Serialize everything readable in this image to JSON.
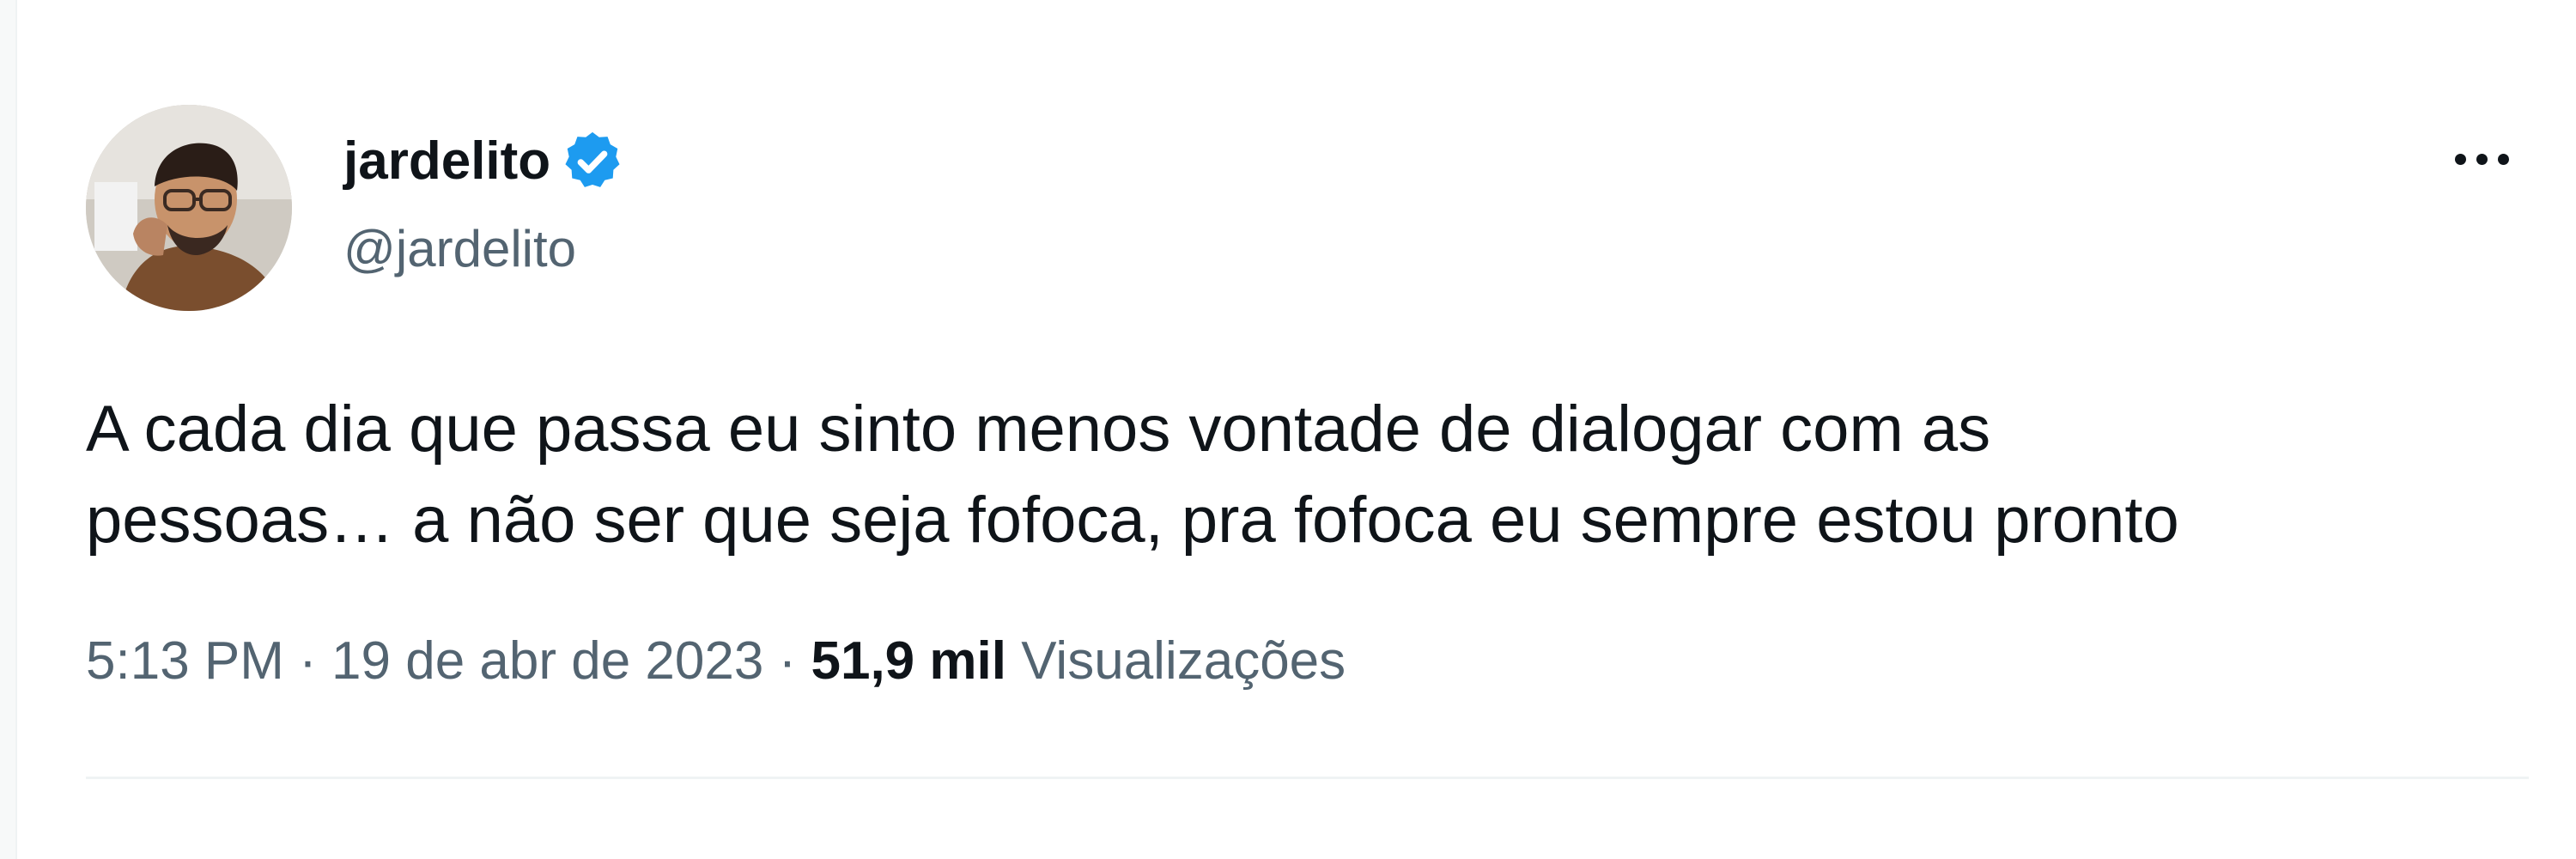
{
  "tweet": {
    "display_name": "jardelito",
    "handle": "@jardelito",
    "verified": true,
    "text": "A cada dia que passa eu sinto menos vontade de dialogar com as\npessoas… a não ser que seja fofoca, pra fofoca eu sempre estou pronto",
    "time": "5:13 PM",
    "separator": "·",
    "date": "19 de abr de 2023",
    "views_count": "51,9 mil",
    "views_label": "Visualizações",
    "icons": {
      "verified": "verified-badge-icon",
      "more": "more-options-icon"
    },
    "colors": {
      "verified": "#1d9bf0",
      "text": "#0f1419",
      "secondary": "#536471"
    }
  }
}
